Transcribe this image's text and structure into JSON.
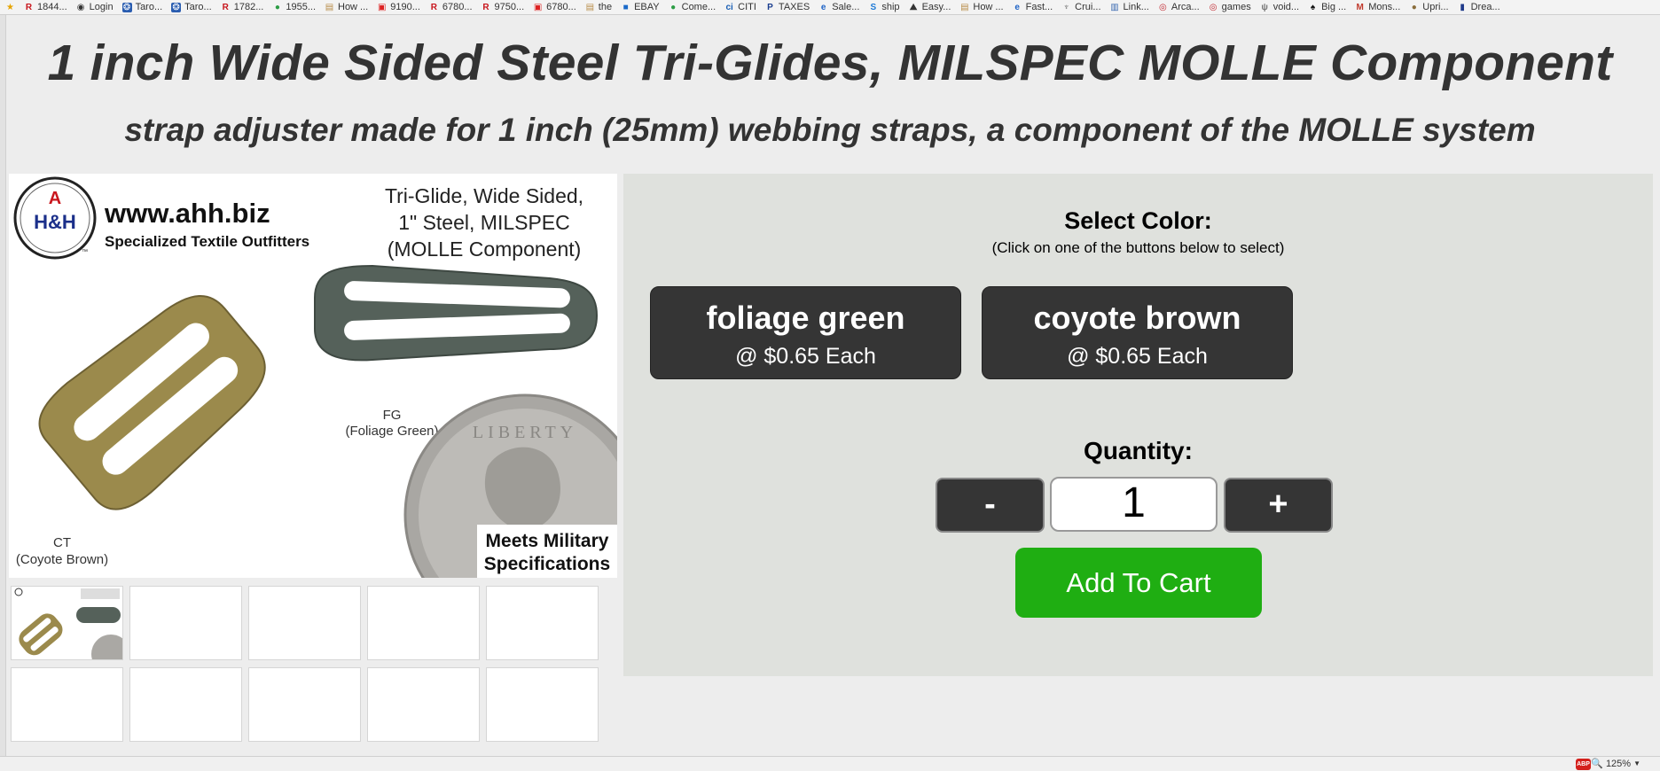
{
  "bookmarks": [
    {
      "label": "",
      "icon": "star-icon"
    },
    {
      "label": "1844...",
      "icon": "r-logo-icon"
    },
    {
      "label": "Login",
      "icon": "login-icon"
    },
    {
      "label": "Taro...",
      "icon": "tarot-icon"
    },
    {
      "label": "Taro...",
      "icon": "tarot-icon"
    },
    {
      "label": "1782...",
      "icon": "r-logo-icon"
    },
    {
      "label": "1955...",
      "icon": "globe-icon"
    },
    {
      "label": "How ...",
      "icon": "page-icon"
    },
    {
      "label": "9190...",
      "icon": "gift-icon"
    },
    {
      "label": "6780...",
      "icon": "r-logo-icon"
    },
    {
      "label": "9750...",
      "icon": "r-logo-icon"
    },
    {
      "label": "6780...",
      "icon": "gift-icon"
    },
    {
      "label": "the",
      "icon": "page-icon"
    },
    {
      "label": "EBAY",
      "icon": "ebay-icon"
    },
    {
      "label": "Come...",
      "icon": "globe-icon"
    },
    {
      "label": "CITI",
      "icon": "citi-icon"
    },
    {
      "label": "TAXES",
      "icon": "paypal-icon"
    },
    {
      "label": "Sale...",
      "icon": "e-icon"
    },
    {
      "label": "ship",
      "icon": "ship-icon"
    },
    {
      "label": "Easy...",
      "icon": "easy-icon"
    },
    {
      "label": "How ...",
      "icon": "page-icon"
    },
    {
      "label": "Fast...",
      "icon": "e-icon"
    },
    {
      "label": "Crui...",
      "icon": "cruise-icon"
    },
    {
      "label": "Link...",
      "icon": "link-icon"
    },
    {
      "label": "Arca...",
      "icon": "eye-icon"
    },
    {
      "label": "games",
      "icon": "eye-icon"
    },
    {
      "label": "void...",
      "icon": "void-icon"
    },
    {
      "label": "Big ...",
      "icon": "spade-icon"
    },
    {
      "label": "Mons...",
      "icon": "mons-icon"
    },
    {
      "label": "Upri...",
      "icon": "upri-icon"
    },
    {
      "label": "Drea...",
      "icon": "drea-icon"
    }
  ],
  "product": {
    "title": "1 inch Wide Sided Steel Tri-Glides, MILSPEC MOLLE Component",
    "subtitle": "strap adjuster made for 1 inch (25mm) webbing straps, a component of the MOLLE system"
  },
  "image": {
    "brand_letter": "A",
    "brand_mark": "H&H",
    "site": "www.ahh.biz",
    "tagline": "Specialized Textile Outfitters",
    "caption_lines": [
      "Tri-Glide, Wide Sided,",
      "1\" Steel, MILSPEC",
      "(MOLLE Component)"
    ],
    "fg_code": "FG",
    "fg_name": "(Foliage Green)",
    "ct_code": "CT",
    "ct_name": "(Coyote Brown)",
    "milspec_line1": "Meets Military",
    "milspec_line2": "Specifications",
    "coin_text": "LIBERTY"
  },
  "thumbnails_count": 10,
  "purchase": {
    "select_title": "Select Color:",
    "select_hint": "(Click on one of the buttons below to select)",
    "colors": [
      {
        "name": "foliage green",
        "price": "@ $0.65 Each"
      },
      {
        "name": "coyote brown",
        "price": "@ $0.65 Each"
      }
    ],
    "quantity_label": "Quantity:",
    "quantity_value": "1",
    "minus_label": "-",
    "plus_label": "+",
    "add_to_cart": "Add To Cart"
  },
  "statusbar": {
    "abp_label": "ABP",
    "zoom": "125%"
  },
  "colors": {
    "button_dark": "#353535",
    "cart_green": "#1fae12",
    "panel_bg": "#dfe1dd"
  }
}
